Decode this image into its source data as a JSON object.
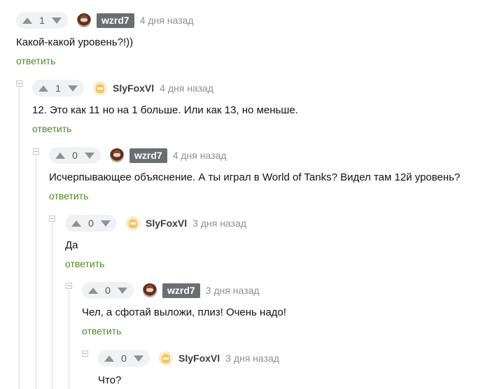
{
  "reply_label": "ответить",
  "comments": [
    {
      "score": "1",
      "author": "wzrd7",
      "time": "4 дня назад",
      "text": "Какой-какой уровень?!))"
    },
    {
      "score": "1",
      "author": "SlyFoxVl",
      "time": "4 дня назад",
      "text": "12. Это как 11 но на 1 больше. Или как 13, но меньше."
    },
    {
      "score": "0",
      "author": "wzrd7",
      "time": "4 дня назад",
      "text": "Исчерпывающее объяснение. А ты играл в World of Tanks? Видел там 12й уровень?"
    },
    {
      "score": "0",
      "author": "SlyFoxVl",
      "time": "3 дня назад",
      "text": "Да"
    },
    {
      "score": "0",
      "author": "wzrd7",
      "time": "3 дня назад",
      "text": "Чел, а сфотай выложи, плиз! Очень надо!"
    },
    {
      "score": "0",
      "author": "SlyFoxVl",
      "time": "3 дня назад",
      "text": "Что?"
    }
  ],
  "colors": {
    "reply_link": "#4d8a2b",
    "username_badge": "#6b6e72",
    "rating_bg": "#f0f1f3"
  }
}
